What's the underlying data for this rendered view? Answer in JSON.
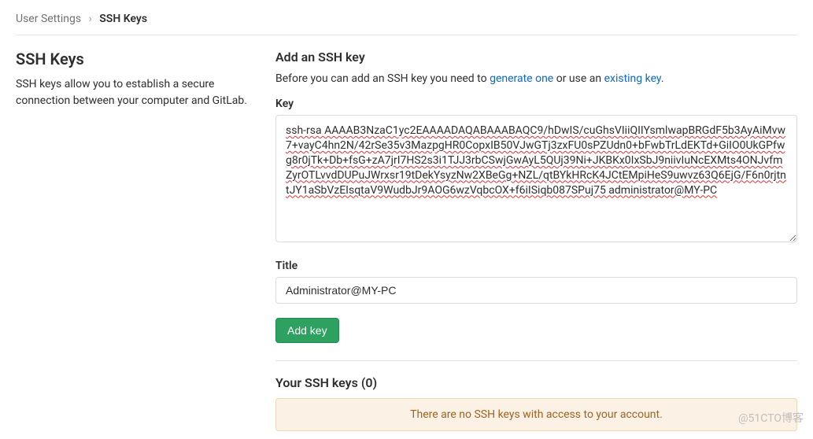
{
  "breadcrumb": {
    "root": "User Settings",
    "sep": "›",
    "current": "SSH Keys"
  },
  "sidebar": {
    "title": "SSH Keys",
    "description": "SSH keys allow you to establish a secure connection between your computer and GitLab."
  },
  "form": {
    "heading": "Add an SSH key",
    "intro_before": "Before you can add an SSH key you need to ",
    "intro_link1": "generate one",
    "intro_mid": " or use an ",
    "intro_link2": "existing key",
    "intro_after": ".",
    "key_label": "Key",
    "key_value": "ssh-rsa AAAAB3NzaC1yc2EAAAADAQABAAABAQC9/hDwIS/cuGhsVIiiQIIYsmlwapBRGdF5b3AyAiMvw7+vayC4hn2N/42rSe35v3MazpgHR0CopxIB50VJwGTj3zxFU0sPZUdn0+bFwbTrLdEKTd+GiIO0UkGPfwg8r0jTk+Db+fsG+zA7jrI7HS2s3i1TJJ3rbCSwjGwAyL5QUj39Ni+JKBKx0IxSbJ9niivIuNcEXMts4ONJvfmZyrOTLvvdDUPuJWrxsr19tDekYsyzNw2XBeGg+NZL/qtBYkHRcK4JCtEMpiHeS9uwvz63Q6EjG/F6n0rjtntJY1aSbVzEIsqtaV9WudbJr9AOG6wzVqbcOX+f6iISiqb087SPuj75 administrator@MY-PC",
    "title_label": "Title",
    "title_value": "Administrator@MY-PC",
    "submit_label": "Add key"
  },
  "list": {
    "heading_prefix": "Your SSH keys (",
    "count": "0",
    "heading_suffix": ")",
    "empty_message": "There are no SSH keys with access to your account."
  },
  "watermark": "@51CTO博客"
}
